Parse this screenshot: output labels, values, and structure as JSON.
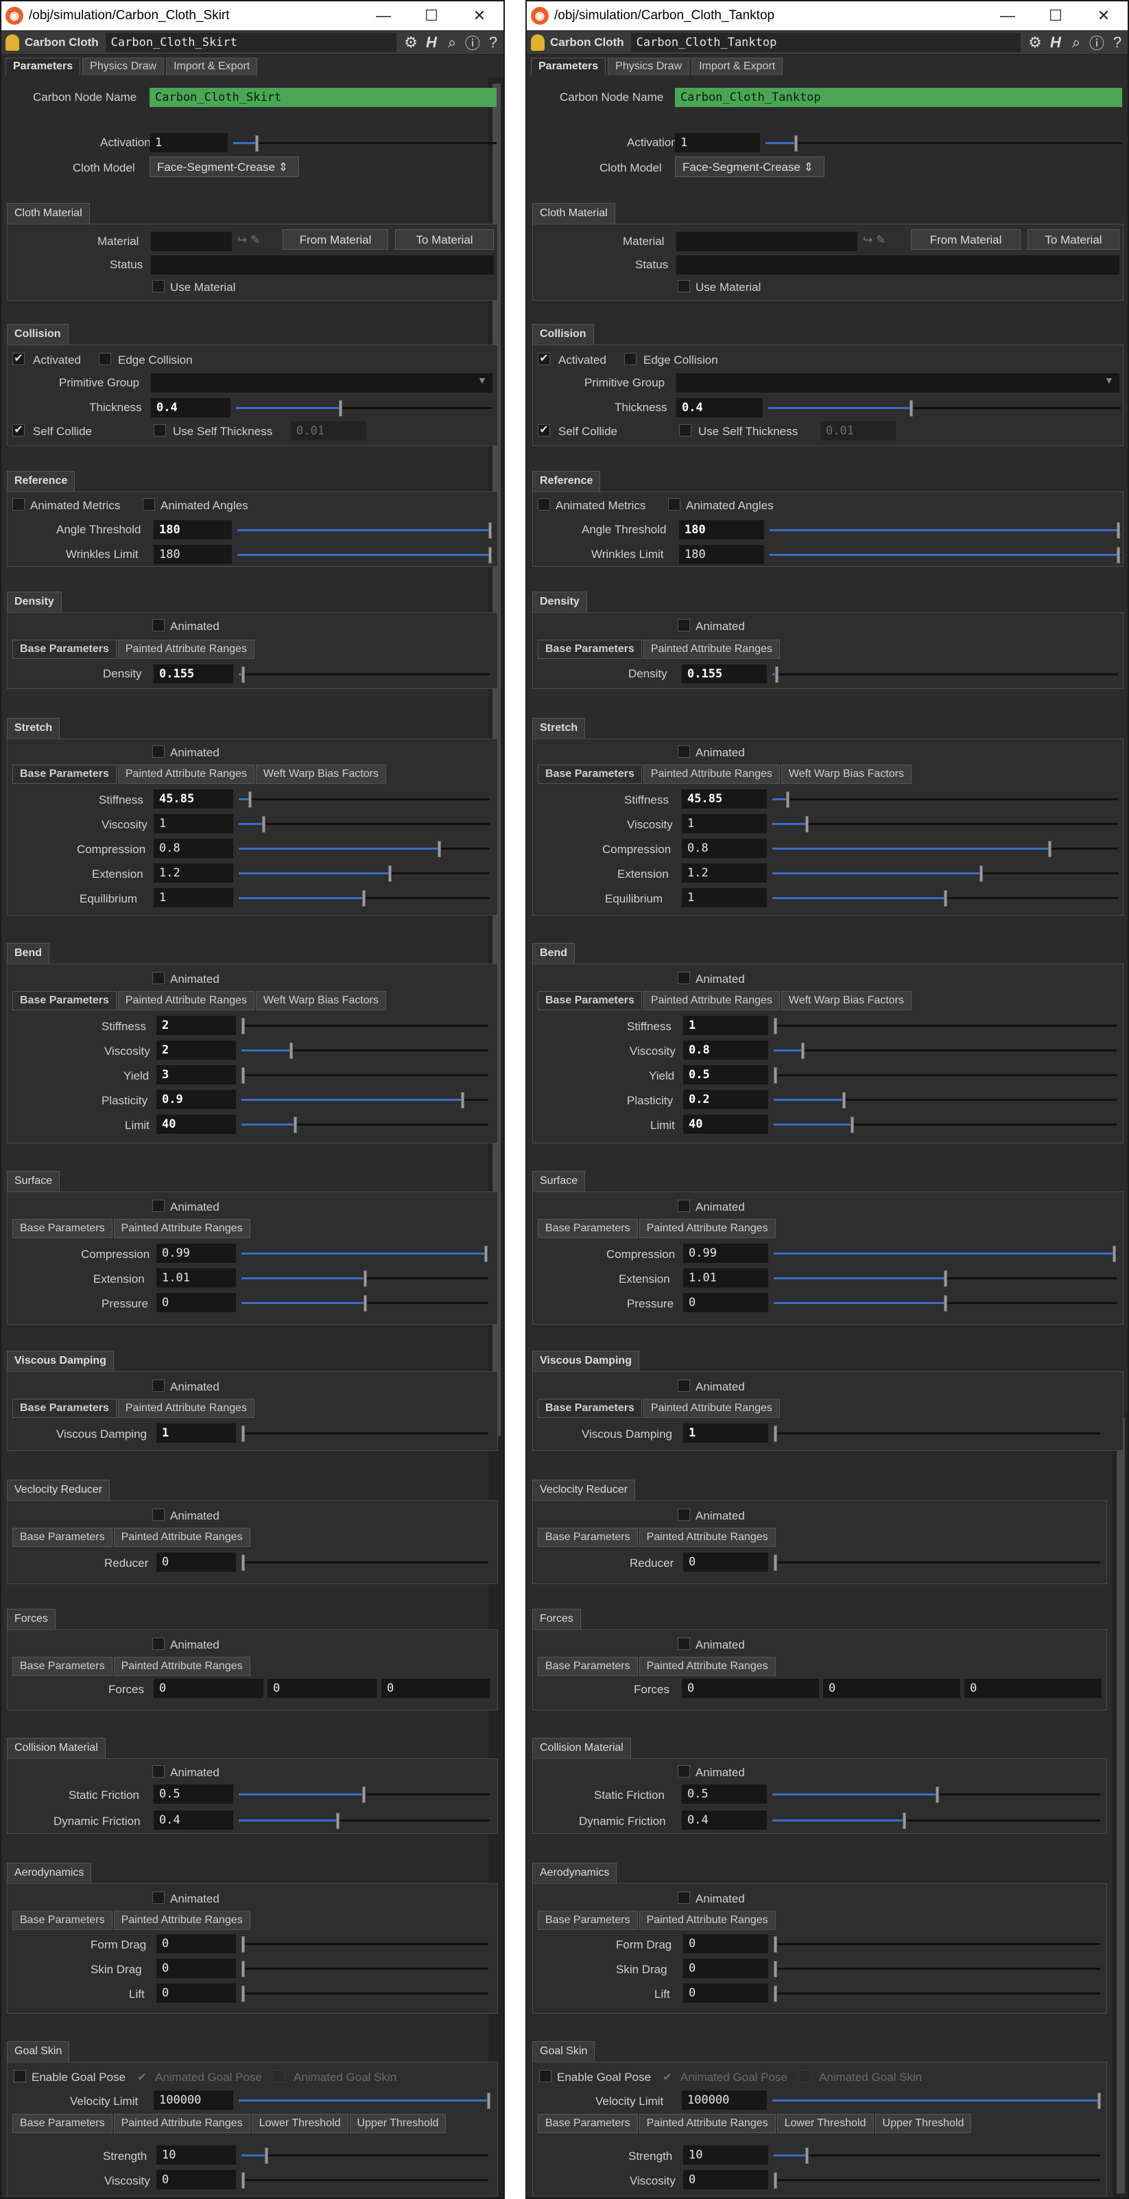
{
  "windows": [
    {
      "title": "/obj/simulation/Carbon_Cloth_Skirt",
      "node_type": "Carbon Cloth",
      "node_name": "Carbon_Cloth_Skirt",
      "bend": {
        "stiffness": "2",
        "viscosity": "2",
        "yield": "3",
        "plasticity": "0.9",
        "limit": "40"
      }
    },
    {
      "title": "/obj/simulation/Carbon_Cloth_Tanktop",
      "node_type": "Carbon Cloth",
      "node_name": "Carbon_Cloth_Tanktop",
      "bend": {
        "stiffness": "1",
        "viscosity": "0.8",
        "yield": "0.5",
        "plasticity": "0.2",
        "limit": "40"
      }
    }
  ],
  "window_buttons": {
    "minimize": "—",
    "maximize": "☐",
    "close": "✕"
  },
  "tabs": [
    "Parameters",
    "Physics Draw",
    "Import & Export"
  ],
  "labels": {
    "carbon_node_name": "Carbon Node Name",
    "activation": "Activation",
    "cloth_model": "Cloth Model",
    "cloth_material": "Cloth Material",
    "material": "Material",
    "status": "Status",
    "use_material": "Use Material",
    "from_material": "From Material",
    "to_material": "To Material",
    "collision": "Collision",
    "activated": "Activated",
    "edge_collision": "Edge Collision",
    "primitive_group": "Primitive Group",
    "thickness": "Thickness",
    "self_collide": "Self Collide",
    "use_self_thickness": "Use Self Thickness",
    "reference": "Reference",
    "animated_metrics": "Animated Metrics",
    "animated_angles": "Animated Angles",
    "angle_threshold": "Angle Threshold",
    "wrinkles_limit": "Wrinkles Limit",
    "density": "Density",
    "animated": "Animated",
    "base_parameters": "Base Parameters",
    "painted_attribute_ranges": "Painted Attribute Ranges",
    "weft_warp_bias_factors": "Weft Warp Bias Factors",
    "stretch": "Stretch",
    "stiffness": "Stiffness",
    "viscosity": "Viscosity",
    "compression": "Compression",
    "extension": "Extension",
    "equilibrium": "Equilibrium",
    "bend": "Bend",
    "yield": "Yield",
    "plasticity": "Plasticity",
    "limit": "Limit",
    "surface": "Surface",
    "pressure": "Pressure",
    "viscous_damping": "Viscous Damping",
    "velocity_reducer": "Veclocity Reducer",
    "reducer": "Reducer",
    "forces": "Forces",
    "collision_material": "Collision Material",
    "static_friction": "Static Friction",
    "dynamic_friction": "Dynamic Friction",
    "aerodynamics": "Aerodynamics",
    "form_drag": "Form Drag",
    "skin_drag": "Skin Drag",
    "lift": "Lift",
    "goal_skin": "Goal Skin",
    "enable_goal_pose": "Enable Goal Pose",
    "animated_goal_pose": "Animated Goal Pose",
    "animated_goal_skin": "Animated Goal Skin",
    "velocity_limit": "Velocity Limit",
    "lower_threshold": "Lower Threshold",
    "upper_threshold": "Upper Threshold",
    "strength": "Strength"
  },
  "values": {
    "activation": "1",
    "cloth_model": "Face-Segment-Crease",
    "thickness": "0.4",
    "self_thickness": "0.01",
    "angle_threshold": "180",
    "wrinkles_limit": "180",
    "density": "0.155",
    "stretch": {
      "stiffness": "45.85",
      "viscosity": "1",
      "compression": "0.8",
      "extension": "1.2",
      "equilibrium": "1"
    },
    "surface": {
      "compression": "0.99",
      "extension": "1.01",
      "pressure": "0"
    },
    "viscous_damping": "1",
    "reducer": "0",
    "forces": [
      "0",
      "0",
      "0"
    ],
    "static_friction": "0.5",
    "dynamic_friction": "0.4",
    "form_drag": "0",
    "skin_drag": "0",
    "lift": "0",
    "velocity_limit": "100000",
    "strength": "10",
    "goal_viscosity": "0"
  },
  "icons": [
    "houdini-logo-icon",
    "bell-icon",
    "gear-icon",
    "help-h-icon",
    "search-icon",
    "info-icon",
    "question-icon",
    "checkmark-icon",
    "dropdown-arrow-icon",
    "material-pick-icon"
  ],
  "colors": {
    "node_name_field": "#4aa654",
    "slider_fill": "#3b6cc7",
    "panel_bg": "#2b2b2b"
  }
}
